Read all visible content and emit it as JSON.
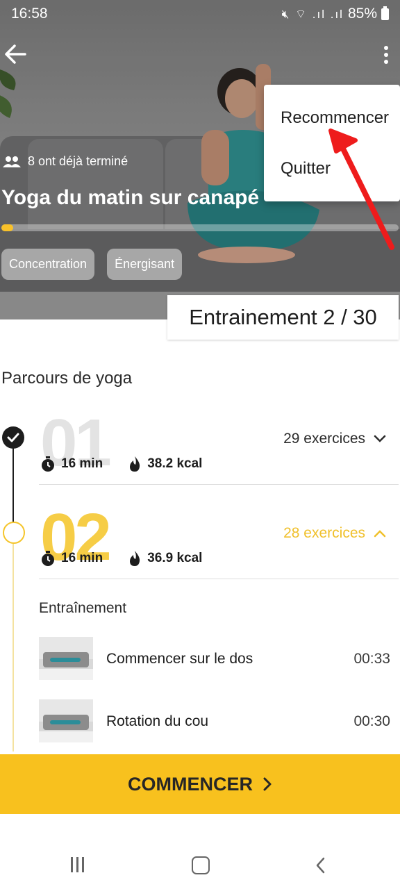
{
  "status_bar": {
    "time": "16:58",
    "icons": "mute wifi signal signal",
    "battery": "85%"
  },
  "hero": {
    "finished_text": "8 ont déjà terminé",
    "title": "Yoga du matin sur canapé",
    "progress_fraction": 0.03,
    "tags": [
      "Concentration",
      "Énergisant"
    ],
    "accent_color": "#f8c12a"
  },
  "menu": {
    "items": [
      "Recommencer",
      "Quitter"
    ]
  },
  "session": {
    "label": "Entrainement 2 / 30"
  },
  "section": {
    "title": "Parcours de yoga"
  },
  "levels": [
    {
      "number": "01",
      "exercises": "29 exercices",
      "duration": "16 min",
      "calories": "38.2 kcal",
      "state": "completed",
      "chevron": "chevron-down-icon"
    },
    {
      "number": "02",
      "exercises": "28 exercices",
      "duration": "16 min",
      "calories": "36.9 kcal",
      "state": "current",
      "chevron": "chevron-up-icon"
    }
  ],
  "training": {
    "title": "Entraînement",
    "exercises": [
      {
        "name": "Commencer sur le dos",
        "time": "00:33"
      },
      {
        "name": "Rotation du cou",
        "time": "00:30"
      }
    ]
  },
  "cta": {
    "label": "COMMENCER"
  },
  "colors": {
    "accent": "#f8c11e",
    "current_level": "#f5c52b",
    "annotation_arrow": "#ee1c1c"
  }
}
